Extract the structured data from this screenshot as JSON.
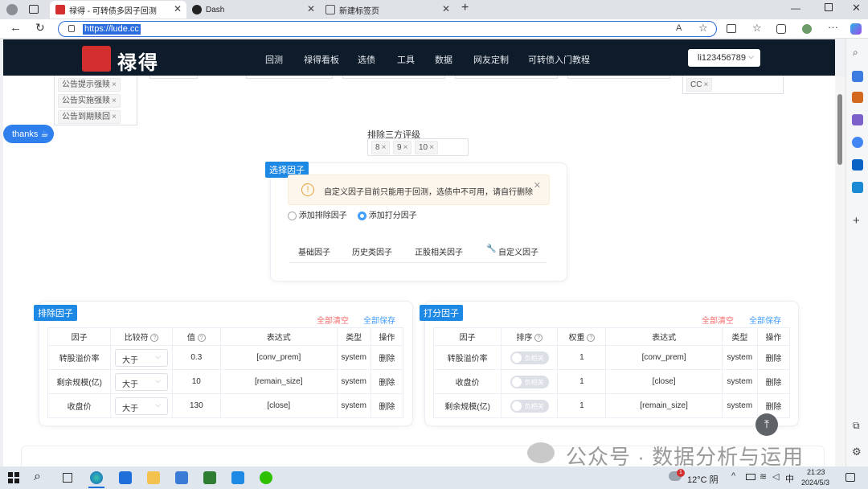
{
  "browser": {
    "tabs": [
      {
        "label": "禄得 - 可转债多因子回测",
        "active": true
      },
      {
        "label": "Dash",
        "active": false
      },
      {
        "label": "新建标签页",
        "active": false
      }
    ],
    "url": "https://lude.cc"
  },
  "site": {
    "logo_text": "禄得",
    "nav": [
      "回测",
      "禄得看板",
      "选债",
      "工具",
      "数据",
      "网友定制",
      "可转债入门教程"
    ],
    "username": "li123456789"
  },
  "top_filters": {
    "left_chips": [
      "公告提示强赎",
      "公告实施强赎",
      "公告到期赎回"
    ],
    "right_chips": [
      "CC"
    ],
    "thanks_button": "thanks",
    "rating_label": "排除三方评级",
    "rating_chips": [
      "8",
      "9",
      "10"
    ]
  },
  "select_factor": {
    "badge": "选择因子",
    "alert": "自定义因子目前只能用于回测，选债中不可用，请自行删除",
    "radio_exclude": "添加排除因子",
    "radio_score": "添加打分因子",
    "tabs": [
      "基础因子",
      "历史类因子",
      "正股相关因子",
      "自定义因子"
    ]
  },
  "exclude_panel": {
    "badge": "排除因子",
    "clear_all": "全部清空",
    "save_all": "全部保存",
    "headers": [
      "因子",
      "比较符",
      "值",
      "表达式",
      "类型",
      "操作"
    ],
    "rows": [
      {
        "factor": "转股溢价率",
        "comparator": "大于",
        "value": "0.3",
        "expr": "[conv_prem]",
        "type": "system",
        "op": "删除"
      },
      {
        "factor": "剩余规模(亿)",
        "comparator": "大于",
        "value": "10",
        "expr": "[remain_size]",
        "type": "system",
        "op": "删除"
      },
      {
        "factor": "收盘价",
        "comparator": "大于",
        "value": "130",
        "expr": "[close]",
        "type": "system",
        "op": "删除"
      }
    ]
  },
  "score_panel": {
    "badge": "打分因子",
    "clear_all": "全部清空",
    "save_all": "全部保存",
    "headers": [
      "因子",
      "排序",
      "权重",
      "表达式",
      "类型",
      "操作"
    ],
    "rows": [
      {
        "factor": "转股溢价率",
        "order": "负相关",
        "weight": "1",
        "expr": "[conv_prem]",
        "type": "system",
        "op": "删除"
      },
      {
        "factor": "收盘价",
        "order": "负相关",
        "weight": "1",
        "expr": "[close]",
        "type": "system",
        "op": "删除"
      },
      {
        "factor": "剩余规模(亿)",
        "order": "负相关",
        "weight": "1",
        "expr": "[remain_size]",
        "type": "system",
        "op": "删除"
      }
    ]
  },
  "watermark": "公众号 · 数据分析与运用",
  "taskbar": {
    "weather": "12°C 阴",
    "ime": "中",
    "time": "21:23",
    "date": "2024/5/3",
    "weather_badge": "1"
  },
  "colors": {
    "accent": "#1e88e5",
    "header_bg": "#0d1b2a",
    "danger": "#f56c6c",
    "link": "#409eff"
  }
}
